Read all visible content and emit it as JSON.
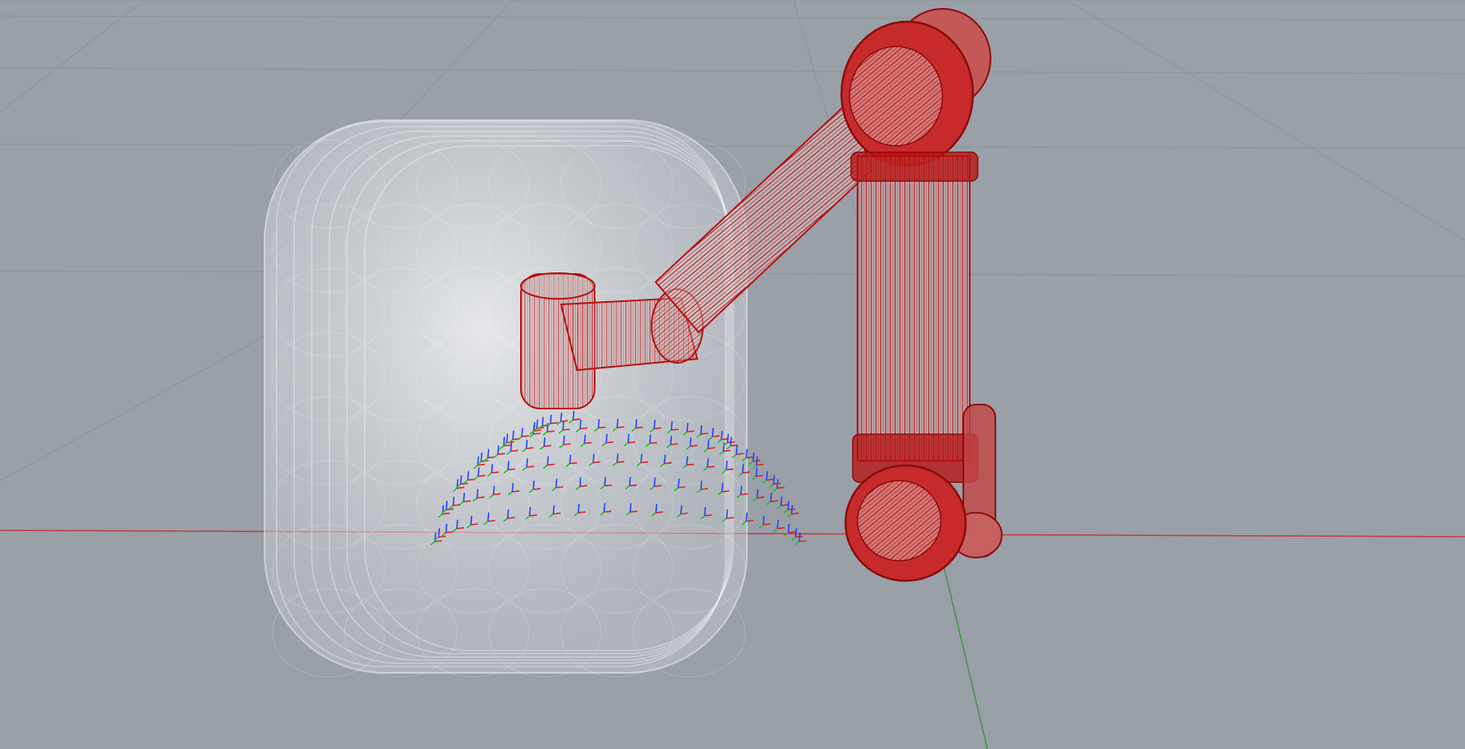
{
  "viewport": {
    "background": "#9aa0a8",
    "grid_color": "#8c939b",
    "view": "perspective"
  },
  "axes": [
    {
      "axis": "x",
      "color": "#c04040"
    },
    {
      "axis": "y",
      "color": "#3f9a3f"
    }
  ],
  "workspace_volume": {
    "shape": "rounded-box",
    "fill": "#e6e8ea",
    "opacity": 0.45,
    "render": "translucent"
  },
  "robot_arm": {
    "render": "wireframe",
    "color": "#b50f0f",
    "joints": [
      "base",
      "shoulder",
      "upper-arm",
      "elbow",
      "forearm",
      "wrist",
      "tool-flange"
    ]
  },
  "target_frames": {
    "count": 110,
    "layout": "hemisphere",
    "frame_axis_colors": {
      "x": "#e02020",
      "y": "#20c020",
      "z": "#2040ff"
    }
  }
}
